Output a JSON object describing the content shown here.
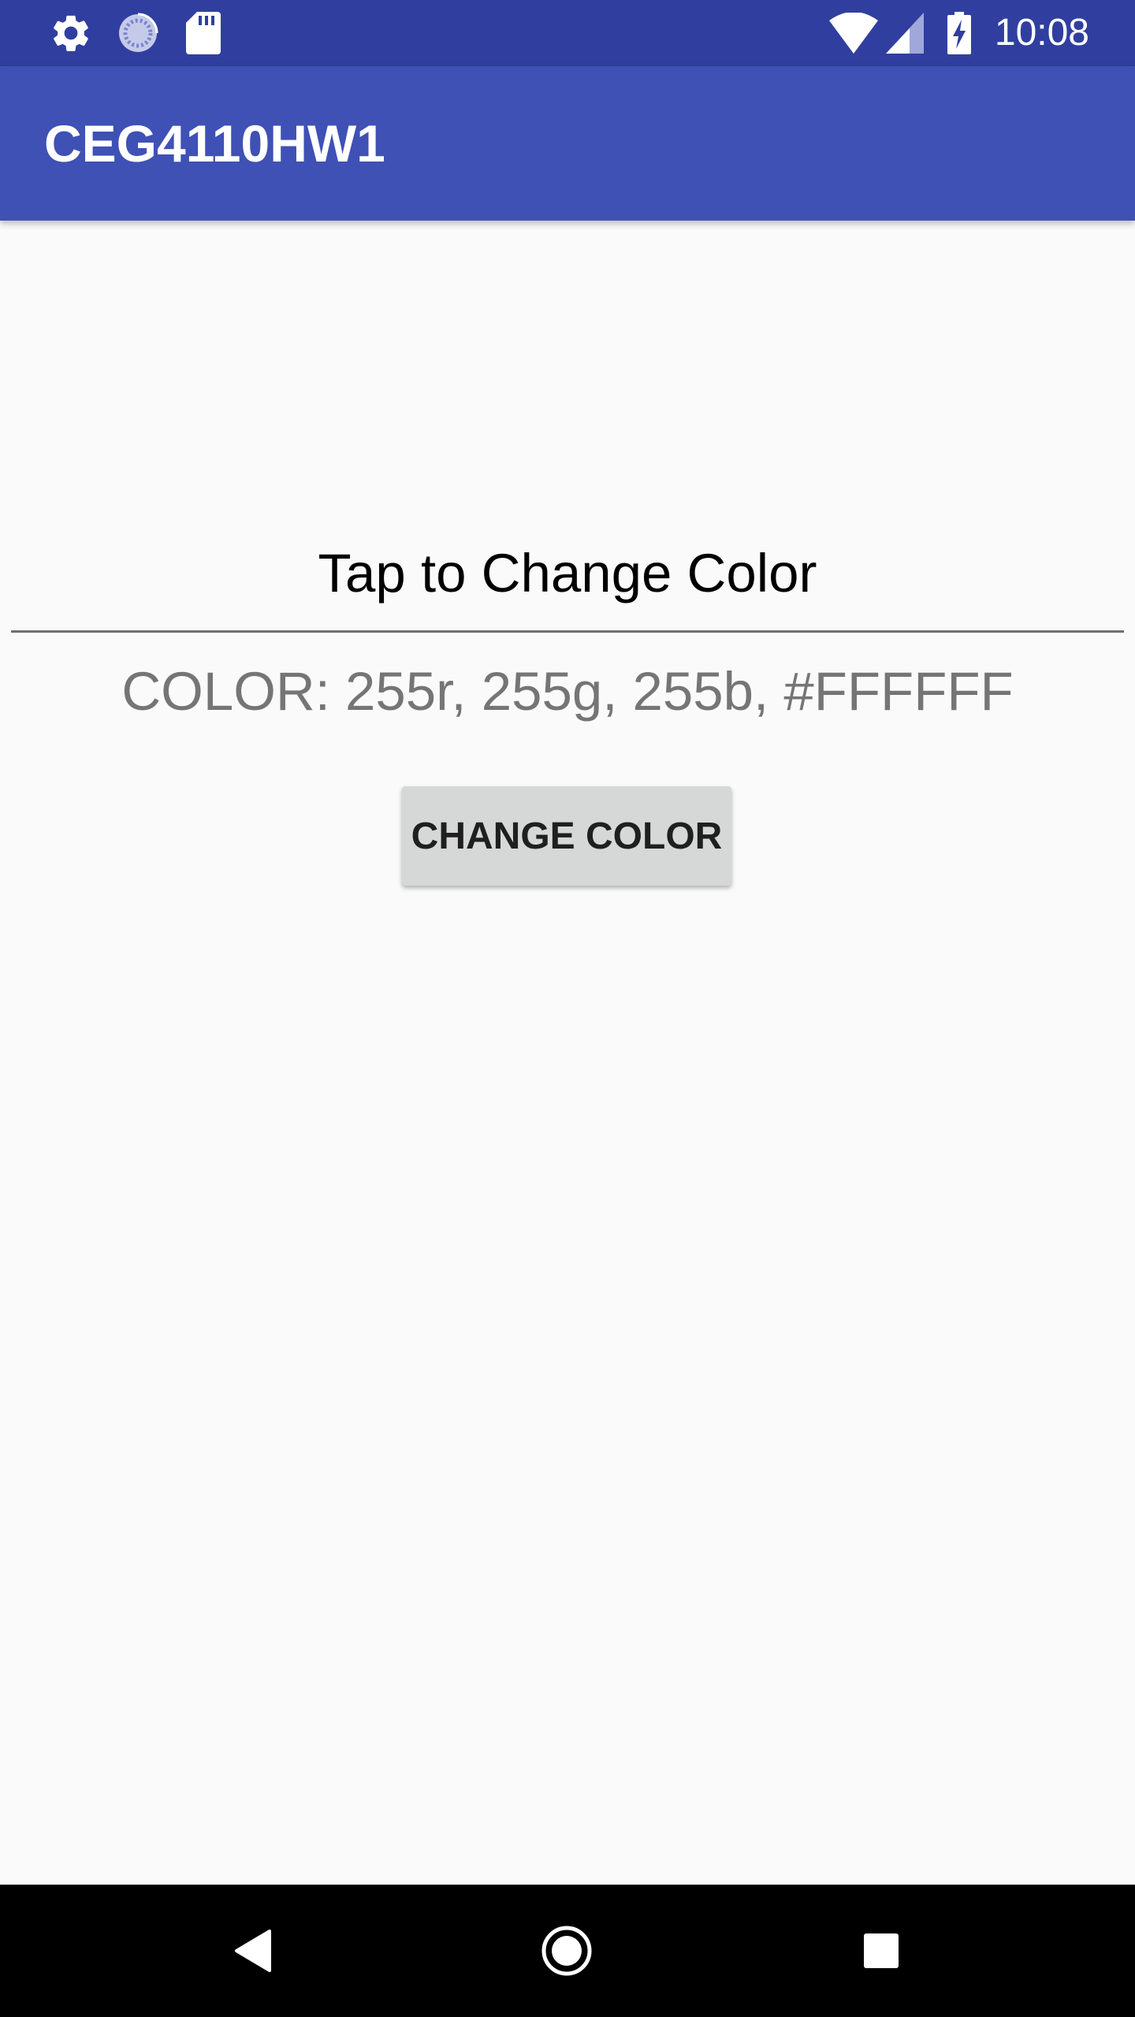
{
  "status_bar": {
    "time": "10:08",
    "icons": [
      "settings-icon",
      "sync-icon",
      "sd-card-icon",
      "wifi-icon",
      "cellular-signal-icon",
      "battery-charging-icon"
    ],
    "background": "#303f9f"
  },
  "app_bar": {
    "title": "CEG4110HW1",
    "background": "#3f51b5"
  },
  "main": {
    "tap_prompt": "Tap to Change Color",
    "color_readout": "COLOR: 255r, 255g, 255b, #FFFFFF",
    "button_label": "CHANGE COLOR"
  },
  "nav_bar": {
    "icons": [
      "back-icon",
      "home-icon",
      "recents-icon"
    ]
  }
}
